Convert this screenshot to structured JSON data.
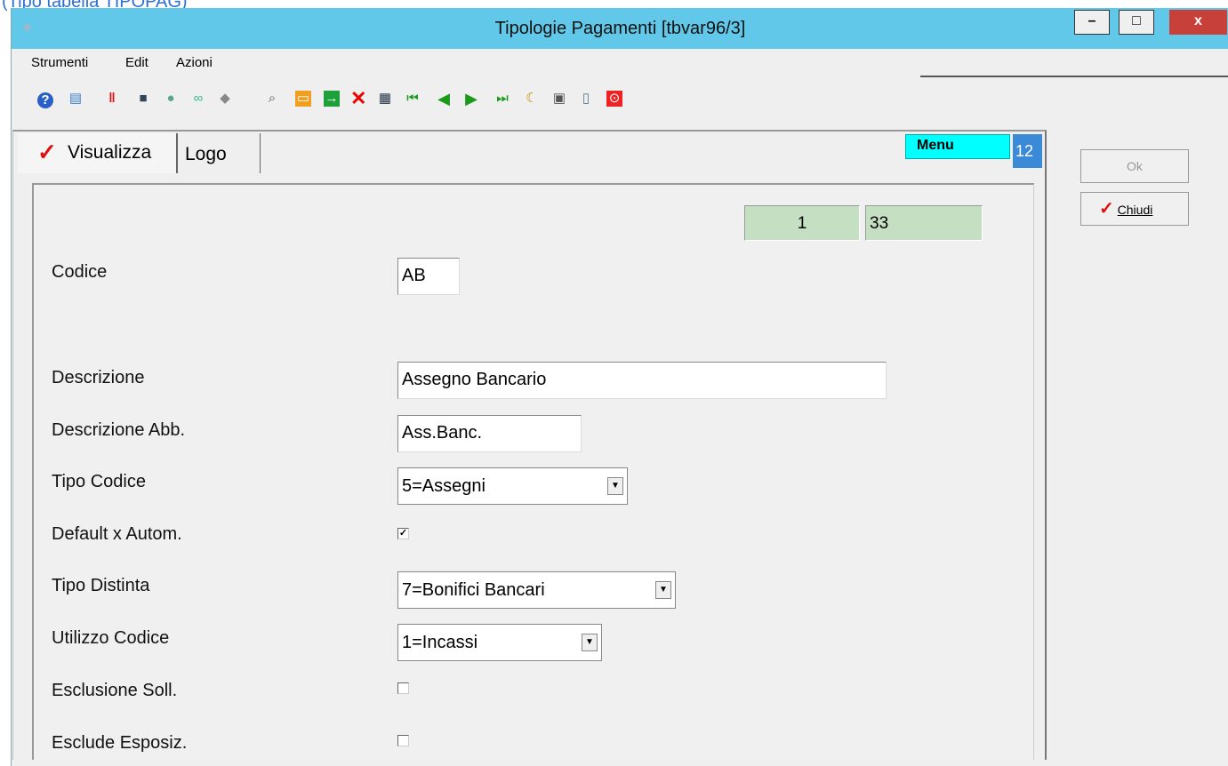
{
  "caption": "(Tipo tabella TIPOPAG)",
  "window": {
    "title": "Tipologie Pagamenti [tbvar96/3]",
    "minimize": "–",
    "maximize": "□",
    "close": "x"
  },
  "menu": {
    "items": [
      "Strumenti",
      "Edit",
      "Azioni"
    ]
  },
  "toolbar": {
    "icons": [
      "help-icon",
      "comment-icon",
      "pause-icon",
      "monitor-icon",
      "palette-icon",
      "link-icon",
      "diamond-icon",
      "search-icon",
      "folder-icon",
      "export-icon",
      "delete-icon",
      "calculator-icon",
      "first-record-icon",
      "previous-record-icon",
      "next-record-icon",
      "last-record-icon",
      "book-icon",
      "print-icon",
      "document-icon",
      "stop-icon"
    ]
  },
  "tabs": {
    "active_label": "Visualizza",
    "logo_label": "Logo"
  },
  "menu_badge": "Menu",
  "num_badge": "12",
  "record": {
    "current": "1",
    "total": "33"
  },
  "form": {
    "codice_label": "Codice",
    "codice_value": "AB",
    "descrizione_label": "Descrizione",
    "descrizione_value": "Assegno Bancario",
    "descrizione_abb_label": "Descrizione Abb.",
    "descrizione_abb_value": "Ass.Banc.",
    "tipo_codice_label": "Tipo Codice",
    "tipo_codice_value": "5=Assegni",
    "default_label": "Default x Autom.",
    "default_checked": true,
    "tipo_distinta_label": "Tipo Distinta",
    "tipo_distinta_value": "7=Bonifici Bancari",
    "utilizzo_label": "Utilizzo Codice",
    "utilizzo_value": "1=Incassi",
    "esclusione_label": "Esclusione Soll.",
    "esclusione_checked": false,
    "esclude_label": "Esclude Esposiz.",
    "esclude_checked": false
  },
  "side_buttons": {
    "ok": "Ok",
    "chiudi": "Chiudi"
  },
  "colors": {
    "titlebar": "#62c8ea",
    "menu_badge": "#00ffff",
    "num_badge": "#3b8ad8",
    "record_field": "#c5dfc2",
    "close_button": "#c8403a"
  }
}
